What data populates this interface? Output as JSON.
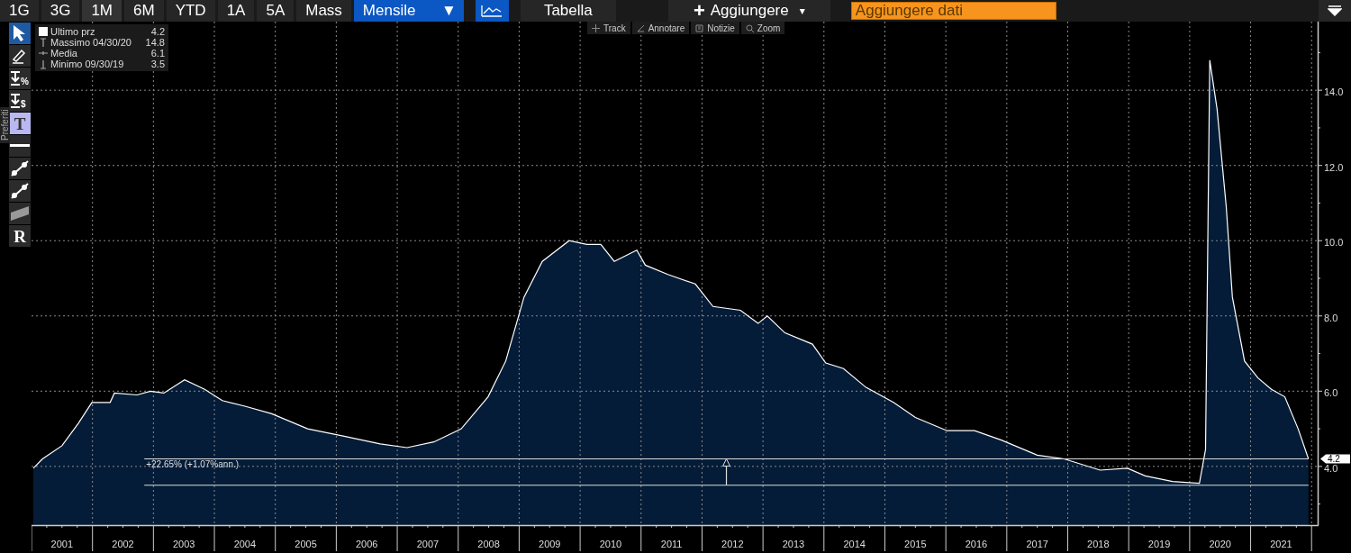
{
  "toolbar": {
    "periods": [
      {
        "label": "1G",
        "selected": false
      },
      {
        "label": "3G",
        "selected": false
      },
      {
        "label": "1M",
        "selected": true
      },
      {
        "label": "6M",
        "selected": false
      },
      {
        "label": "YTD",
        "selected": false
      },
      {
        "label": "1A",
        "selected": false
      },
      {
        "label": "5A",
        "selected": false
      },
      {
        "label": "Mass",
        "selected": false
      }
    ],
    "frequency": {
      "label": "Mensile",
      "caret": "▼"
    },
    "table_button": "Tabella",
    "add_button": {
      "plus": "+",
      "label": "Aggiungere",
      "caret": "▾"
    },
    "data_field": {
      "value": "Aggiungere dati"
    }
  },
  "chart_tools": [
    {
      "label": "Track"
    },
    {
      "label": "Annotare"
    },
    {
      "label": "Notizie"
    },
    {
      "label": "Zoom"
    }
  ],
  "side_tab": "Preferiti",
  "drawing_tools": [
    {
      "kind": "pointer",
      "selected": true,
      "active": false
    },
    {
      "kind": "pen",
      "selected": false,
      "active": false
    },
    {
      "kind": "marker",
      "glyph": "%",
      "selected": false,
      "active": false
    },
    {
      "kind": "marker",
      "glyph": "$",
      "selected": false,
      "active": false
    },
    {
      "kind": "letter",
      "glyph": "T",
      "selected": false,
      "active": true
    },
    {
      "kind": "hline",
      "selected": false,
      "active": false
    },
    {
      "kind": "trend",
      "selected": false,
      "active": false
    },
    {
      "kind": "trend",
      "selected": false,
      "active": false
    },
    {
      "kind": "channel",
      "selected": false,
      "active": false
    },
    {
      "kind": "letter",
      "glyph": "R",
      "selected": false,
      "active": false
    }
  ],
  "legend": [
    {
      "kind": "last",
      "value": "4.2"
    },
    {
      "kind": "high",
      "label": "Massimo 04/30/20",
      "value": "14.8"
    },
    {
      "kind": "mean",
      "label": "Media",
      "value": "6.1"
    },
    {
      "kind": "low",
      "label": "Minimo 09/30/19",
      "value": "3.5"
    }
  ],
  "chart": {
    "chart_data": {
      "type": "area",
      "xlim": [
        2001.0,
        2022.1
      ],
      "ylim": [
        2.44,
        15.8
      ],
      "x": [
        2001.03,
        2001.18,
        2001.5,
        2001.77,
        2001.99,
        2002.29,
        2002.36,
        2002.73,
        2002.95,
        2003.17,
        2003.51,
        2003.84,
        2004.13,
        2004.5,
        2004.94,
        2005.53,
        2006.13,
        2006.72,
        2007.16,
        2007.6,
        2008.05,
        2008.49,
        2008.78,
        2009.08,
        2009.38,
        2009.82,
        2010.11,
        2010.34,
        2010.56,
        2010.93,
        2011.07,
        2011.44,
        2011.89,
        2012.18,
        2012.63,
        2012.92,
        2013.07,
        2013.36,
        2013.81,
        2014.03,
        2014.32,
        2014.69,
        2015.14,
        2015.5,
        2016.02,
        2016.47,
        2016.91,
        2017.5,
        2017.94,
        2018.53,
        2018.98,
        2019.27,
        2019.72,
        2020.16,
        2020.26,
        2020.33,
        2020.45,
        2020.6,
        2020.7,
        2020.9,
        2021.12,
        2021.34,
        2021.56,
        2021.78,
        2021.95
      ],
      "series": [
        {
          "name": "Ultimo prz",
          "color": "#ffffff",
          "values": [
            3.95,
            4.2,
            4.55,
            5.15,
            5.7,
            5.7,
            5.95,
            5.9,
            6.0,
            5.95,
            6.3,
            6.05,
            5.75,
            5.6,
            5.4,
            5.0,
            4.8,
            4.6,
            4.5,
            4.65,
            5.0,
            5.85,
            6.8,
            8.5,
            9.45,
            10.0,
            9.9,
            9.9,
            9.45,
            9.75,
            9.35,
            9.1,
            8.85,
            8.25,
            8.15,
            7.8,
            8.0,
            7.55,
            7.25,
            6.75,
            6.6,
            6.1,
            5.7,
            5.3,
            4.95,
            4.95,
            4.7,
            4.3,
            4.2,
            3.9,
            3.95,
            3.75,
            3.6,
            3.55,
            4.45,
            14.8,
            13.5,
            10.9,
            8.5,
            6.8,
            6.35,
            6.05,
            5.85,
            5.0,
            4.2
          ]
        }
      ],
      "xticks": [
        {
          "value": 2001.5,
          "label": "2001"
        },
        {
          "value": 2002.5,
          "label": "2002"
        },
        {
          "value": 2003.5,
          "label": "2003"
        },
        {
          "value": 2004.5,
          "label": "2004"
        },
        {
          "value": 2005.5,
          "label": "2005"
        },
        {
          "value": 2006.5,
          "label": "2006"
        },
        {
          "value": 2007.5,
          "label": "2007"
        },
        {
          "value": 2008.5,
          "label": "2008"
        },
        {
          "value": 2009.5,
          "label": "2009"
        },
        {
          "value": 2010.5,
          "label": "2010"
        },
        {
          "value": 2011.5,
          "label": "2011"
        },
        {
          "value": 2012.5,
          "label": "2012"
        },
        {
          "value": 2013.5,
          "label": "2013"
        },
        {
          "value": 2014.5,
          "label": "2014"
        },
        {
          "value": 2015.5,
          "label": "2015"
        },
        {
          "value": 2016.5,
          "label": "2016"
        },
        {
          "value": 2017.5,
          "label": "2017"
        },
        {
          "value": 2018.5,
          "label": "2018"
        },
        {
          "value": 2019.5,
          "label": "2019"
        },
        {
          "value": 2020.5,
          "label": "2020"
        },
        {
          "value": 2021.5,
          "label": "2021"
        }
      ],
      "yticks": [
        {
          "value": 4,
          "label": "4.0"
        },
        {
          "value": 6,
          "label": "6.0"
        },
        {
          "value": 8,
          "label": "8.0"
        },
        {
          "value": 10,
          "label": "10.0"
        },
        {
          "value": 12,
          "label": "12.0"
        },
        {
          "value": 14,
          "label": "14.0"
        }
      ],
      "grid": true,
      "ref_lines": [
        {
          "axis": "y",
          "value": 4.2
        },
        {
          "axis": "y",
          "value": 3.5
        }
      ],
      "annotations": [
        {
          "text": "+22.65% (+1.07%ann.)",
          "x": 2002.85,
          "y": 4.2
        }
      ]
    },
    "last_price_tag": "4.2"
  }
}
